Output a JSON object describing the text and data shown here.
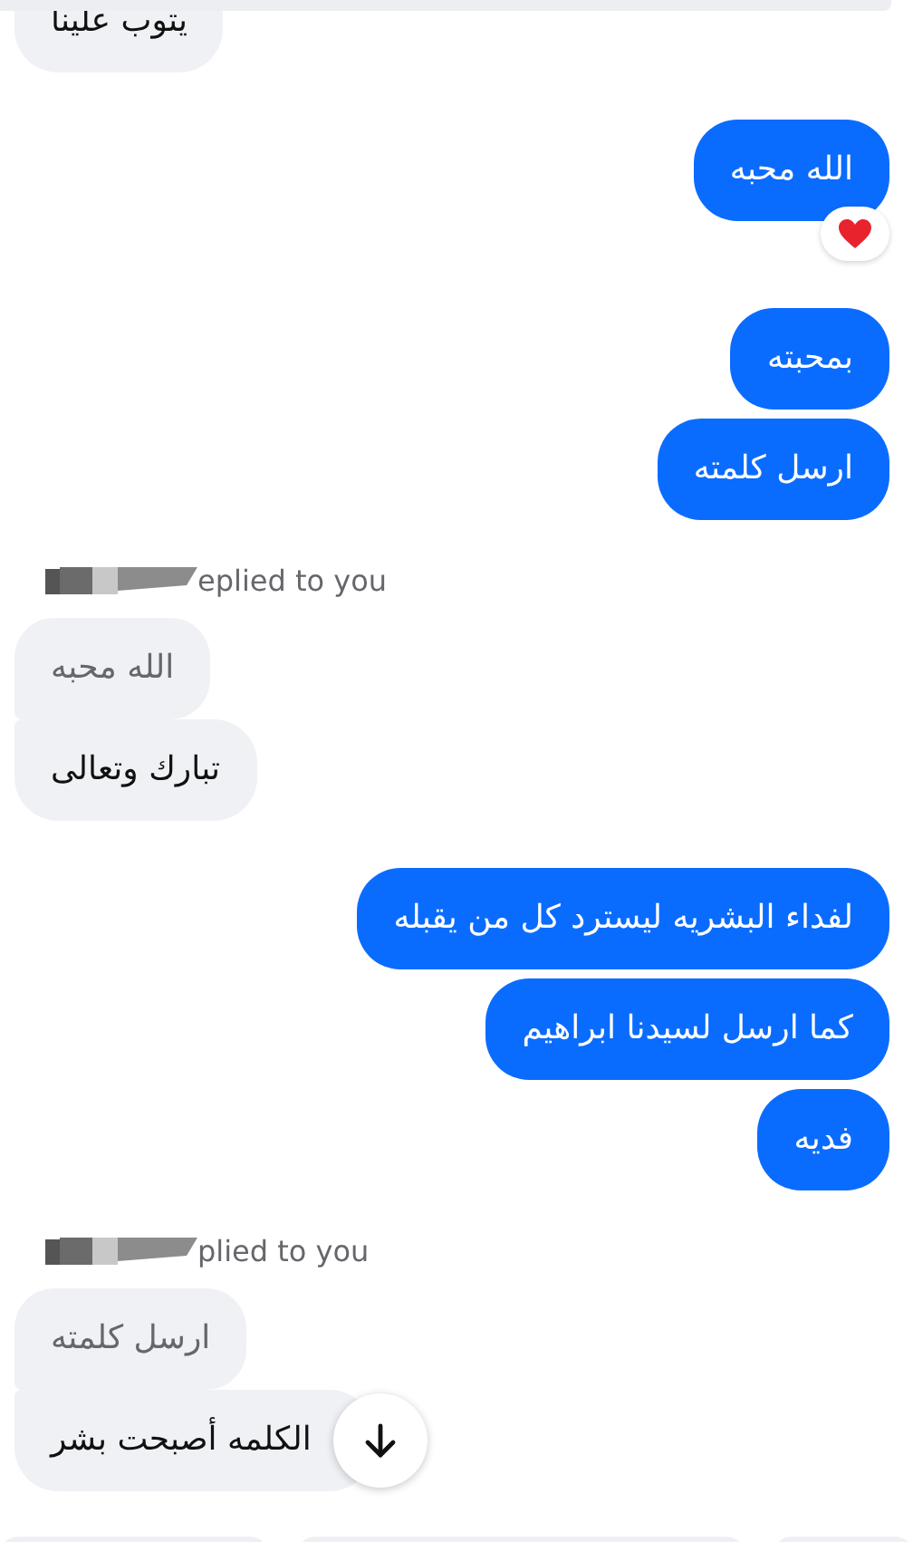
{
  "groups": [
    {
      "kind": "received",
      "messages": [
        {
          "text": "يتوب علينا"
        }
      ]
    },
    {
      "kind": "sent",
      "messages": [
        {
          "text": "الله محبه",
          "reacted": true
        }
      ]
    },
    {
      "kind": "sent",
      "messages": [
        {
          "text": "بمحبته",
          "reacted": false
        },
        {
          "text": "ارسل كلمته",
          "reacted": false
        }
      ]
    },
    {
      "kind": "reply",
      "reply_label": "eplied to you",
      "quoted": "الله محبه",
      "text": "تبارك وتعالى"
    },
    {
      "kind": "sent",
      "messages": [
        {
          "text": "لفداء البشريه ليسترد كل من يقبله",
          "reacted": false
        },
        {
          "text": "كما ارسل لسيدنا ابراهيم",
          "reacted": false
        },
        {
          "text": "فديه",
          "reacted": false
        }
      ]
    },
    {
      "kind": "reply",
      "reply_label": "plied to you",
      "quoted": "ارسل كلمته",
      "text": "الكلمه أصبحت بشر",
      "scroll_button": true
    }
  ]
}
